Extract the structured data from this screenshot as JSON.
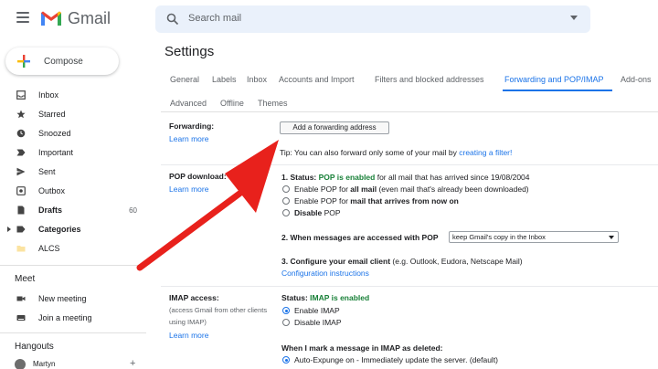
{
  "header": {
    "app_name": "Gmail",
    "search_placeholder": "Search mail"
  },
  "compose_label": "Compose",
  "sidebar": {
    "items": [
      {
        "label": "Inbox",
        "icon": "inbox-icon"
      },
      {
        "label": "Starred",
        "icon": "star-icon"
      },
      {
        "label": "Snoozed",
        "icon": "clock-icon"
      },
      {
        "label": "Important",
        "icon": "important-icon"
      },
      {
        "label": "Sent",
        "icon": "send-icon"
      },
      {
        "label": "Outbox",
        "icon": "outbox-icon"
      },
      {
        "label": "Drafts",
        "icon": "draft-icon",
        "count": "60"
      },
      {
        "label": "Categories",
        "icon": "label-icon"
      },
      {
        "label": "ALCS",
        "icon": "folder-icon"
      }
    ],
    "meet_title": "Meet",
    "meet_items": [
      {
        "label": "New meeting",
        "icon": "video-icon"
      },
      {
        "label": "Join a meeting",
        "icon": "keyboard-icon"
      }
    ],
    "hangouts_title": "Hangouts",
    "hangouts_user": "Martyn"
  },
  "settings": {
    "title": "Settings",
    "tabs": [
      "General",
      "Labels",
      "Inbox",
      "Accounts and Import",
      "Filters and blocked addresses",
      "Forwarding and POP/IMAP",
      "Add-ons"
    ],
    "tabs_row2": [
      "Advanced",
      "Offline",
      "Themes"
    ],
    "active_tab": "Forwarding and POP/IMAP",
    "forwarding": {
      "label": "Forwarding:",
      "learn_more": "Learn more",
      "button": "Add a forwarding address",
      "tip_text": "Tip: You can also forward only some of your mail by",
      "tip_link": "creating a filter!"
    },
    "pop": {
      "label": "POP download:",
      "learn_more": "Learn more",
      "status_prefix": "1. Status: ",
      "status_value": "POP is enabled",
      "status_suffix": " for all mail that has arrived since 19/08/2004",
      "opt1_a": "Enable POP for ",
      "opt1_b": "all mail",
      "opt1_c": " (even mail that's already been downloaded)",
      "opt2_a": "Enable POP for ",
      "opt2_b": "mail that arrives from now on",
      "opt3_a": "Disable",
      "opt3_b": " POP",
      "step2": "2. When messages are accessed with POP",
      "step2_select": "keep Gmail's copy in the Inbox",
      "step3_a": "3. Configure your email client",
      "step3_b": " (e.g. Outlook, Eudora, Netscape Mail)",
      "config_link": "Configuration instructions"
    },
    "imap": {
      "label": "IMAP access:",
      "desc1": "(access Gmail from other clients",
      "desc2": "using IMAP)",
      "learn_more": "Learn more",
      "status_prefix": "Status: ",
      "status_value": "IMAP is enabled",
      "opt_enable": "Enable IMAP",
      "opt_disable": "Disable IMAP",
      "deleted_title": "When I mark a message in IMAP as deleted:",
      "auto_expunge": "Auto-Expunge on - Immediately update the server. (default)"
    }
  },
  "colors": {
    "accent": "#1a73e8",
    "enabled_green": "#188038",
    "annotation_arrow": "#e8211c"
  }
}
